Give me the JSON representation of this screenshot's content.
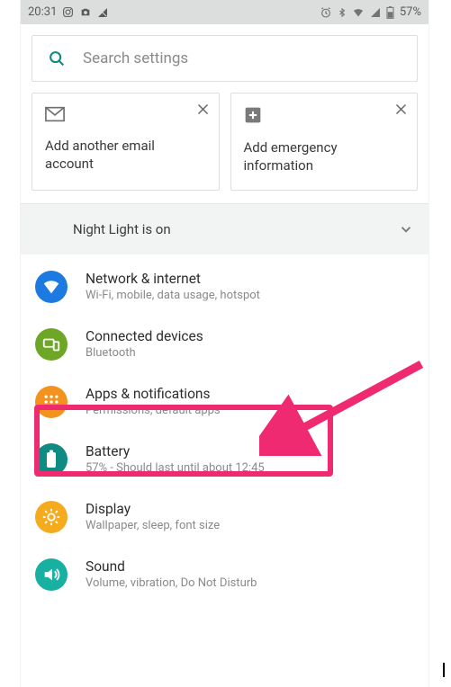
{
  "statusbar": {
    "time": "20:31",
    "battery": "57%"
  },
  "search": {
    "placeholder": "Search settings"
  },
  "cards": [
    {
      "icon": "gmail-icon",
      "title": "Add another email account"
    },
    {
      "icon": "plus-box-icon",
      "title": "Add emergency information"
    }
  ],
  "banner": {
    "label": "Night Light is on"
  },
  "items": [
    {
      "title": "Network & internet",
      "sub": "Wi-Fi, mobile, data usage, hotspot"
    },
    {
      "title": "Connected devices",
      "sub": "Bluetooth"
    },
    {
      "title": "Apps & notifications",
      "sub": "Permissions, default apps"
    },
    {
      "title": "Battery",
      "sub": "57% - Should last until about 12:45"
    },
    {
      "title": "Display",
      "sub": "Wallpaper, sleep, font size"
    },
    {
      "title": "Sound",
      "sub": "Volume, vibration, Do Not Disturb"
    }
  ]
}
